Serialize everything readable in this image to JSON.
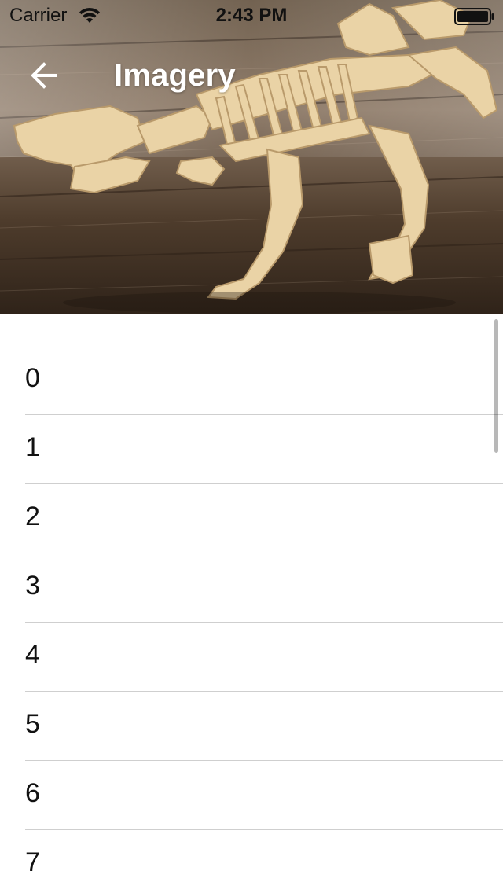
{
  "status_bar": {
    "carrier": "Carrier",
    "time": "2:43 PM",
    "wifi_icon": "wifi-icon",
    "battery_icon": "battery-full-icon"
  },
  "toolbar": {
    "title": "Imagery",
    "back_icon": "arrow-left-icon"
  },
  "hero": {
    "image_description_icon": "hero-image"
  },
  "list": {
    "items": [
      {
        "label": "0"
      },
      {
        "label": "1"
      },
      {
        "label": "2"
      },
      {
        "label": "3"
      },
      {
        "label": "4"
      },
      {
        "label": "5"
      },
      {
        "label": "6"
      },
      {
        "label": "7"
      }
    ]
  },
  "colors": {
    "title_text": "#ffffff",
    "divider": "#cfcfcf",
    "list_text": "#111111",
    "wood_dark": "#3e3024",
    "wood_light": "#e7cfa3"
  }
}
